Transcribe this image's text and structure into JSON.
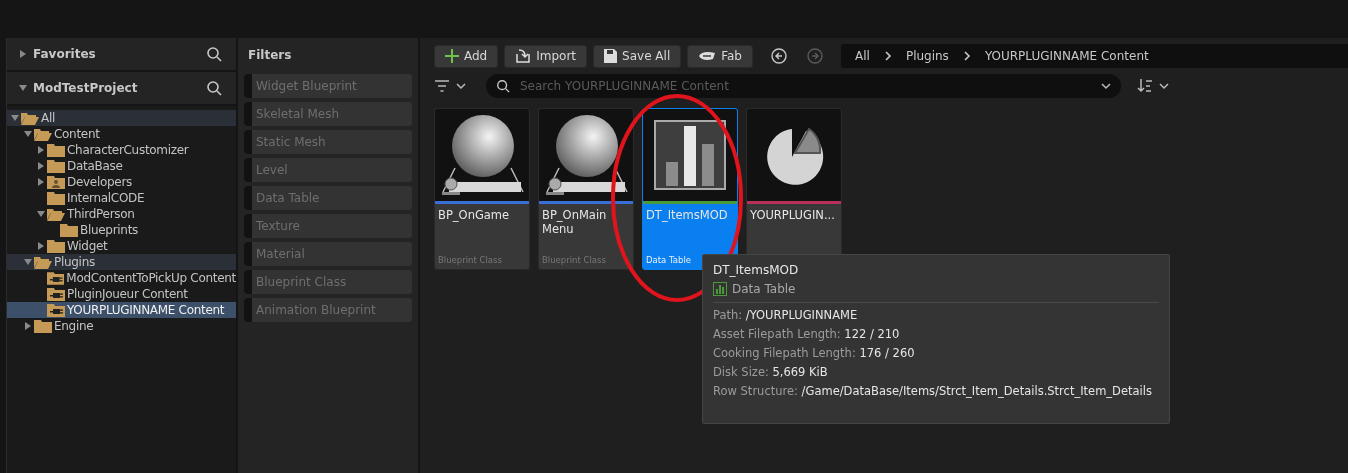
{
  "favorites": {
    "title": "Favorites",
    "expanded": false
  },
  "project": {
    "title": "ModTestProject",
    "expanded": true
  },
  "tree": [
    {
      "label": "All",
      "kind": "open",
      "expanded": true,
      "selected": false,
      "highlight": true,
      "children": [
        {
          "label": "Content",
          "kind": "open",
          "expanded": true,
          "selected": false,
          "highlight": false,
          "children": [
            {
              "label": "CharacterCustomizer",
              "kind": "folder",
              "expanded": false,
              "selected": false,
              "highlight": false
            },
            {
              "label": "DataBase",
              "kind": "folder",
              "expanded": false,
              "selected": false,
              "highlight": false
            },
            {
              "label": "Developers",
              "kind": "developers",
              "expanded": false,
              "selected": false,
              "highlight": false
            },
            {
              "label": "InternalCODE",
              "kind": "folder",
              "selected": false,
              "highlight": false
            },
            {
              "label": "ThirdPerson",
              "kind": "open",
              "expanded": true,
              "selected": false,
              "highlight": false,
              "children": [
                {
                  "label": "Blueprints",
                  "kind": "folder",
                  "selected": false,
                  "highlight": false
                }
              ]
            },
            {
              "label": "Widget",
              "kind": "folder",
              "expanded": false,
              "selected": false,
              "highlight": false
            }
          ]
        },
        {
          "label": "Plugins",
          "kind": "open",
          "expanded": true,
          "selected": false,
          "highlight": true,
          "children": [
            {
              "label": "ModContentToPickUp Content",
              "kind": "plugin",
              "selected": false,
              "highlight": false
            },
            {
              "label": "PluginJoueur Content",
              "kind": "plugin",
              "selected": false,
              "highlight": false
            },
            {
              "label": "YOURPLUGINNAME Content",
              "kind": "plugin",
              "selected": true,
              "highlight": false
            }
          ]
        },
        {
          "label": "Engine",
          "kind": "folder",
          "expanded": false,
          "selected": false,
          "highlight": false
        }
      ]
    }
  ],
  "filters": {
    "title": "Filters",
    "items": [
      {
        "label": "Widget Blueprint",
        "checked": false
      },
      {
        "label": "Skeletal Mesh",
        "checked": false
      },
      {
        "label": "Static Mesh",
        "checked": false
      },
      {
        "label": "Level",
        "checked": false
      },
      {
        "label": "Data Table",
        "checked": false
      },
      {
        "label": "Texture",
        "checked": false
      },
      {
        "label": "Material",
        "checked": false
      },
      {
        "label": "Blueprint Class",
        "checked": false
      },
      {
        "label": "Animation Blueprint",
        "checked": false
      }
    ]
  },
  "toolbar": [
    {
      "label": "Add",
      "kind": "add"
    },
    {
      "label": "Import",
      "kind": "import"
    },
    {
      "label": "Save All",
      "kind": "save"
    },
    {
      "label": "Fab",
      "kind": "fab"
    }
  ],
  "nav": {
    "back_disabled": false,
    "forward_disabled": true
  },
  "breadcrumb": [
    "All",
    "Plugins",
    "YOURPLUGINNAME Content"
  ],
  "search": {
    "placeholder": "Search YOURPLUGINNAME Content"
  },
  "assets": [
    {
      "name": "BP_OnGame",
      "type": "Blueprint Class",
      "kind": "blueprint",
      "color": "#3a6fd8",
      "selected": false
    },
    {
      "name": "BP_OnMain Menu",
      "type": "Blueprint Class",
      "kind": "blueprint",
      "color": "#3a6fd8",
      "selected": false
    },
    {
      "name": "DT_ItemsMOD",
      "type": "Data Table",
      "kind": "datatable",
      "color": "#4a9a3a",
      "selected": true
    },
    {
      "name": "YOURPLUGIN...",
      "kind": "pie",
      "color": "#b8305a",
      "selected": false
    }
  ],
  "tooltip": {
    "title": "DT_ItemsMOD",
    "type": "Data Table",
    "rows": [
      {
        "label": "Path:",
        "value": "/YOURPLUGINNAME"
      },
      {
        "label": "Asset Filepath Length:",
        "value": "122 / 210"
      },
      {
        "label": "Cooking Filepath Length:",
        "value": "176 / 260"
      },
      {
        "label": "Disk Size:",
        "value": "5,669 KiB"
      },
      {
        "label": "Row Structure:",
        "value": "/Game/DataBase/Items/Strct_Item_Details.Strct_Item_Details"
      }
    ]
  },
  "annotation": {
    "color": "#e0141c"
  }
}
